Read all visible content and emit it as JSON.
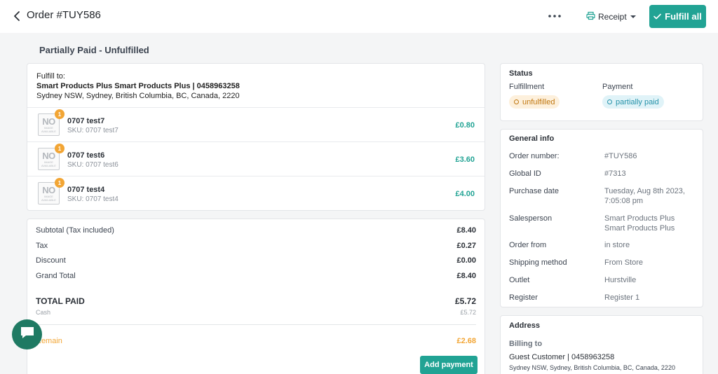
{
  "header": {
    "title": "Order #TUY586",
    "receipt_label": "Receipt",
    "fulfill_all_label": "Fulfill all"
  },
  "order_status_heading": "Partially Paid - Unfulfilled",
  "fulfill": {
    "label": "Fulfill to:",
    "name": "Smart Products Plus Smart Products Plus | 0458963258",
    "address": "Sydney NSW, Sydney, British Columbia, BC, Canada, 2220"
  },
  "no_image": {
    "big": "NO",
    "line1": "IMAGE",
    "line2": "AVAILABLE"
  },
  "items": [
    {
      "name": "0707 test7",
      "sku": "SKU: 0707 test7",
      "price": "£0.80",
      "qty": "1"
    },
    {
      "name": "0707 test6",
      "sku": "SKU: 0707 test6",
      "price": "£3.60",
      "qty": "1"
    },
    {
      "name": "0707 test4",
      "sku": "SKU: 0707 test4",
      "price": "£4.00",
      "qty": "1"
    }
  ],
  "summary": {
    "subtotal_label": "Subtotal (Tax included)",
    "subtotal": "£8.40",
    "tax_label": "Tax",
    "tax": "£0.27",
    "discount_label": "Discount",
    "discount": "£0.00",
    "grand_total_label": "Grand Total",
    "grand_total": "£8.40",
    "total_paid_label": "TOTAL PAID",
    "total_paid": "£5.72",
    "cash_label": "Cash",
    "cash": "£5.72",
    "remain_label": "Remain",
    "remain": "£2.68",
    "add_payment_label": "Add payment"
  },
  "status": {
    "title": "Status",
    "fulfillment_label": "Fulfillment",
    "fulfillment_value": "unfulfilled",
    "payment_label": "Payment",
    "payment_value": "partially paid"
  },
  "general_info": {
    "title": "General info",
    "rows": [
      {
        "label": "Order number:",
        "value": "#TUY586"
      },
      {
        "label": "Global ID",
        "value": "#7313"
      },
      {
        "label": "Purchase date",
        "value": "Tuesday, Aug 8th 2023, 7:05:08 pm"
      },
      {
        "label": "Salesperson",
        "value": "Smart Products Plus Smart Products Plus"
      },
      {
        "label": "Order from",
        "value": "in store"
      },
      {
        "label": "Shipping method",
        "value": "From Store"
      },
      {
        "label": "Outlet",
        "value": "Hurstville"
      },
      {
        "label": "Register",
        "value": "Register 1"
      }
    ]
  },
  "address": {
    "title": "Address",
    "billing_label": "Billing to",
    "billing_name": "Guest Customer | 0458963258",
    "billing_address": "Sydney NSW, Sydney, British Columbia, BC, Canada, 2220"
  },
  "colors": {
    "accent": "#21a394",
    "warning": "#f2a534",
    "info": "#2592a9"
  }
}
